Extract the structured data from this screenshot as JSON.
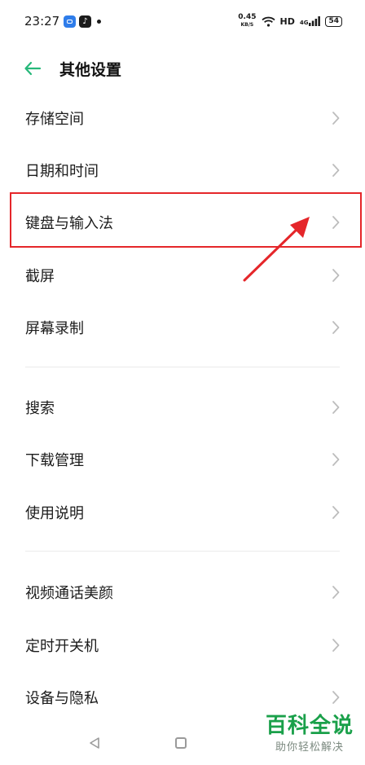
{
  "status_bar": {
    "time": "23:27",
    "tiktok_glyph": "♪",
    "net_speed": "0.45",
    "net_unit": "KB/S",
    "hd": "HD",
    "signal": "4G",
    "battery": "54"
  },
  "header": {
    "title": "其他设置"
  },
  "groups": [
    {
      "items": [
        {
          "label": "存储空间"
        },
        {
          "label": "日期和时间"
        },
        {
          "label": "键盘与输入法"
        },
        {
          "label": "截屏"
        },
        {
          "label": "屏幕录制"
        }
      ]
    },
    {
      "items": [
        {
          "label": "搜索"
        },
        {
          "label": "下载管理"
        },
        {
          "label": "使用说明"
        }
      ]
    },
    {
      "items": [
        {
          "label": "视频通话美颜"
        },
        {
          "label": "定时开关机"
        },
        {
          "label": "设备与隐私"
        }
      ]
    }
  ],
  "watermark": {
    "title": "百科全说",
    "subtitle": "助你轻松解决"
  },
  "colors": {
    "accent": "#27b87a",
    "annotation": "#e5262a",
    "watermark": "#1aa04a"
  }
}
